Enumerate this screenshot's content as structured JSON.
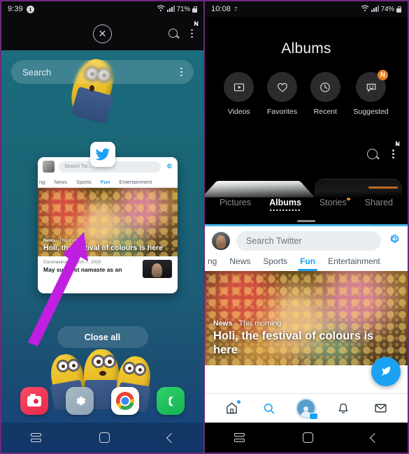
{
  "left_panel": {
    "status_bar": {
      "time": "9:39",
      "notification_badge": "1",
      "battery": "71%",
      "wifi_icon": "wifi-icon",
      "signal_icon": "signal-icon",
      "lock_icon": "lock-icon"
    },
    "recents_header": {
      "close_icon": "close-circle-icon",
      "search_icon": "search-icon",
      "menu_icon": "kebab-menu-icon",
      "menu_badge": "N"
    },
    "search": {
      "placeholder": "Search",
      "menu_icon": "kebab-menu-icon"
    },
    "app_card": {
      "logo": "twitter-bird-icon",
      "search_placeholder": "Search Tw...",
      "settings_icon": "gear-icon",
      "tabs": [
        "ng",
        "News",
        "Sports",
        "Fun",
        "Entertainment"
      ],
      "selected_tab": "Fun",
      "news_kicker_bold": "News",
      "news_kicker_light": " · This morning",
      "news_title": "Holi, the festival of colours is here",
      "tweet_meta": "Coronavirus · March 7, 2020",
      "tweet_body": "May suggest namaste as an"
    },
    "close_all_label": "Close all",
    "dock": [
      {
        "name": "camera-app-icon",
        "label": "Camera"
      },
      {
        "name": "settings-app-icon",
        "label": "Settings"
      },
      {
        "name": "chrome-app-icon",
        "label": "Chrome"
      },
      {
        "name": "phone-app-icon",
        "label": "Phone"
      }
    ],
    "nav_bar": {
      "recents_icon": "recents-icon",
      "home_icon": "home-icon",
      "back_icon": "back-icon"
    },
    "annotation": {
      "type": "arrow",
      "color": "#c01fe0"
    }
  },
  "right_panel": {
    "status_bar": {
      "time": "10:08",
      "notification_count": "7",
      "battery": "74%",
      "wifi_icon": "wifi-icon",
      "signal_icon": "signal-icon",
      "lock_icon": "lock-icon"
    },
    "gallery": {
      "title": "Albums",
      "albums": [
        {
          "label": "Videos",
          "icon": "video-icon",
          "badge": ""
        },
        {
          "label": "Favorites",
          "icon": "heart-icon",
          "badge": ""
        },
        {
          "label": "Recent",
          "icon": "clock-icon",
          "badge": ""
        },
        {
          "label": "Suggested",
          "icon": "suggestion-bubble-icon",
          "badge": "N"
        }
      ],
      "search_icon": "search-icon",
      "menu_icon": "kebab-menu-icon",
      "menu_badge": "N",
      "tabs": [
        {
          "label": "Pictures",
          "selected": false,
          "dot": false
        },
        {
          "label": "Albums",
          "selected": true,
          "dot": false
        },
        {
          "label": "Stories",
          "selected": false,
          "dot": true
        },
        {
          "label": "Shared",
          "selected": false,
          "dot": false
        }
      ]
    },
    "twitter": {
      "search_placeholder": "Search Twitter",
      "settings_icon": "gear-icon",
      "avatar": "profile-avatar",
      "tabs": [
        "ng",
        "News",
        "Sports",
        "Fun",
        "Entertainment"
      ],
      "selected_tab": "Fun",
      "news_kicker_bold": "News",
      "news_kicker_light": " · This morning",
      "news_title": "Holi, the festival of colours is here",
      "compose_icon": "compose-feather-icon",
      "bottom_nav": [
        {
          "name": "home-icon",
          "badge": true
        },
        {
          "name": "search-icon",
          "badge": false
        },
        {
          "name": "profile-icon",
          "badge": true
        },
        {
          "name": "notifications-bell-icon",
          "badge": false
        },
        {
          "name": "messages-envelope-icon",
          "badge": false
        }
      ]
    },
    "nav_bar": {
      "recents_icon": "recents-icon",
      "home_icon": "home-icon",
      "back_icon": "back-icon"
    }
  }
}
